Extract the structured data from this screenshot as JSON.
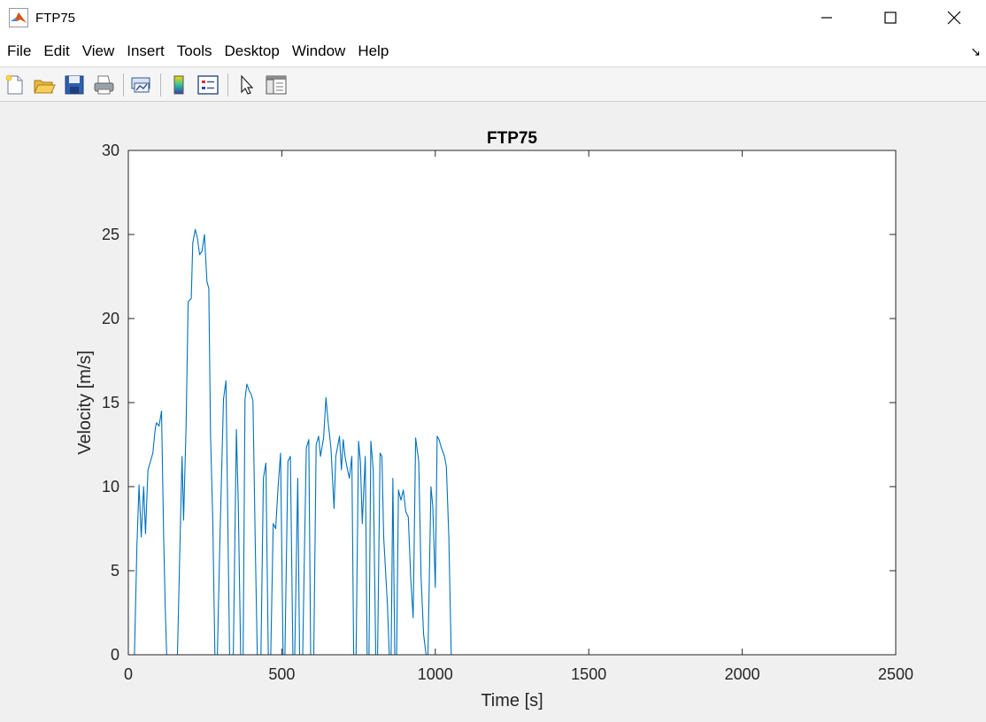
{
  "window": {
    "title": "FTP75",
    "app_icon": "matlab-logo-icon",
    "controls": [
      "minimize-icon",
      "maximize-icon",
      "close-icon"
    ]
  },
  "menu": {
    "items": [
      "File",
      "Edit",
      "View",
      "Insert",
      "Tools",
      "Desktop",
      "Window",
      "Help"
    ],
    "overflow_icon": "dock-arrow-icon"
  },
  "toolbar": {
    "buttons": [
      "new-figure-icon",
      "open-file-icon",
      "save-icon",
      "print-icon",
      "link-plot-icon",
      "colorbar-icon",
      "legend-icon",
      "pointer-icon",
      "property-editor-icon"
    ]
  },
  "colors": {
    "line": "#0072bd",
    "axes_bg": "#ffffff",
    "figure_bg": "#f0f0f0"
  },
  "chart_data": {
    "type": "line",
    "title": "FTP75",
    "xlabel": "Time [s]",
    "ylabel": "Velocity [m/s]",
    "xlim": [
      0,
      2500
    ],
    "ylim": [
      0,
      30
    ],
    "xticks": [
      0,
      500,
      1000,
      1500,
      2000,
      2500
    ],
    "yticks": [
      0,
      5,
      10,
      15,
      20,
      25,
      30
    ],
    "grid": false,
    "x": [
      0,
      20,
      28,
      35,
      42,
      50,
      56,
      64,
      72,
      80,
      88,
      92,
      100,
      108,
      115,
      120,
      125,
      135,
      145,
      160,
      168,
      175,
      180,
      188,
      195,
      205,
      210,
      218,
      225,
      232,
      240,
      248,
      256,
      262,
      268,
      275,
      282,
      290,
      298,
      310,
      318,
      330,
      342,
      352,
      358,
      366,
      374,
      380,
      386,
      394,
      400,
      406,
      414,
      420,
      432,
      440,
      448,
      456,
      464,
      472,
      480,
      488,
      496,
      504,
      510,
      520,
      528,
      536,
      542,
      552,
      558,
      568,
      574,
      580,
      588,
      594,
      604,
      612,
      620,
      626,
      636,
      644,
      650,
      660,
      670,
      676,
      688,
      694,
      700,
      706,
      712,
      720,
      728,
      734,
      742,
      750,
      756,
      762,
      772,
      778,
      784,
      790,
      798,
      806,
      812,
      820,
      826,
      832,
      838,
      844,
      850,
      856,
      862,
      868,
      874,
      880,
      888,
      896,
      904,
      912,
      920,
      928,
      936,
      946,
      954,
      962,
      970,
      976,
      986,
      992,
      1000,
      1006,
      1012,
      1020,
      1030,
      1036,
      1044,
      1052,
      1060,
      1066,
      1076,
      1082,
      1092,
      1098,
      1106,
      1112,
      1120,
      1128,
      1136,
      1144,
      1150,
      1158,
      1166,
      1172,
      1180,
      1186,
      1192,
      1198,
      1206,
      1214,
      1222,
      1228,
      1236,
      1242,
      1248,
      1252,
      1260,
      1268,
      1274,
      1280,
      1288,
      1296,
      1302,
      1308,
      1312,
      1318,
      1326,
      1332,
      1338,
      1346,
      1352,
      1358,
      1366,
      1380,
      1500,
      1800,
      1988,
      1994,
      2000,
      2006,
      2012,
      2018,
      2024,
      2030,
      2036,
      2044,
      2052,
      2060,
      2068,
      2076,
      2084,
      2092,
      2098,
      2106,
      2112,
      2120,
      2128,
      2136,
      2142,
      2150,
      2156,
      2162,
      2168,
      2176,
      2184,
      2192,
      2200,
      2208,
      2214,
      2222,
      2228,
      2236,
      2242,
      2250,
      2258,
      2266,
      2274,
      2280,
      2288,
      2296,
      2302,
      2310,
      2320,
      2330,
      2340,
      2346,
      2354,
      2360,
      2366,
      2372,
      2380,
      2388,
      2396,
      2404,
      2412,
      2420,
      2428,
      2436,
      2444,
      2452,
      2460,
      2466,
      2472,
      2478,
      2500
    ],
    "y": [
      0,
      0,
      6.5,
      10.1,
      7.0,
      10.0,
      7.2,
      11.0,
      11.5,
      12.0,
      13.5,
      13.8,
      13.6,
      14.5,
      7.0,
      3.0,
      0,
      0,
      0,
      0,
      6.5,
      11.8,
      8.0,
      13.5,
      21.0,
      21.2,
      24.5,
      25.3,
      24.8,
      23.8,
      24.0,
      25.0,
      22.2,
      21.8,
      13.0,
      8.0,
      0,
      0,
      6.5,
      15.2,
      16.3,
      0,
      0,
      13.4,
      9.0,
      0,
      0,
      15.2,
      16.1,
      15.7,
      15.5,
      15.1,
      6.0,
      0,
      0,
      10.5,
      11.4,
      0,
      0,
      7.8,
      7.5,
      10.0,
      12.0,
      0,
      0,
      11.5,
      11.8,
      0,
      0,
      10.5,
      0,
      0,
      6.5,
      12.3,
      12.8,
      0,
      0,
      12.5,
      13.0,
      11.8,
      12.9,
      15.3,
      14.0,
      12.3,
      8.7,
      11.8,
      13.0,
      11.0,
      12.8,
      11.8,
      11.2,
      10.5,
      11.8,
      0,
      0,
      12.7,
      11.5,
      7.8,
      11.8,
      0,
      0,
      12.7,
      11.0,
      0,
      0,
      12.0,
      11.8,
      7.0,
      5.0,
      3.0,
      0,
      0,
      10.5,
      0,
      0,
      9.8,
      9.2,
      9.8,
      8.5,
      8.2,
      4.5,
      2.2,
      12.9,
      11.5,
      4.5,
      1.2,
      0,
      0,
      10.0,
      8.8,
      4.0,
      13.0,
      12.8,
      12.3,
      11.8,
      11.2,
      7.0,
      0,
      0,
      0,
      0,
      0,
      0,
      0,
      0,
      0,
      0,
      0,
      0,
      0,
      0,
      0,
      0,
      0,
      0,
      0,
      0,
      0,
      0,
      0,
      0,
      0,
      0,
      0,
      0,
      0,
      0,
      0,
      0,
      0,
      0,
      0,
      0,
      0,
      0,
      0,
      0,
      0,
      0,
      0,
      0,
      0,
      0,
      0,
      0,
      0,
      0,
      0,
      0,
      0,
      0,
      0,
      0,
      0,
      0,
      0,
      0,
      0,
      0,
      0,
      0,
      0,
      0,
      0,
      0,
      0,
      0,
      0,
      0,
      0,
      0,
      0,
      0,
      0,
      0,
      0,
      0,
      0,
      0,
      0,
      0,
      0,
      0,
      0,
      0,
      0,
      0,
      0,
      0,
      0,
      0,
      0,
      0,
      0,
      0,
      0,
      0,
      0,
      0,
      0,
      0,
      0,
      0,
      0,
      0,
      0,
      0,
      0,
      0,
      0
    ]
  }
}
